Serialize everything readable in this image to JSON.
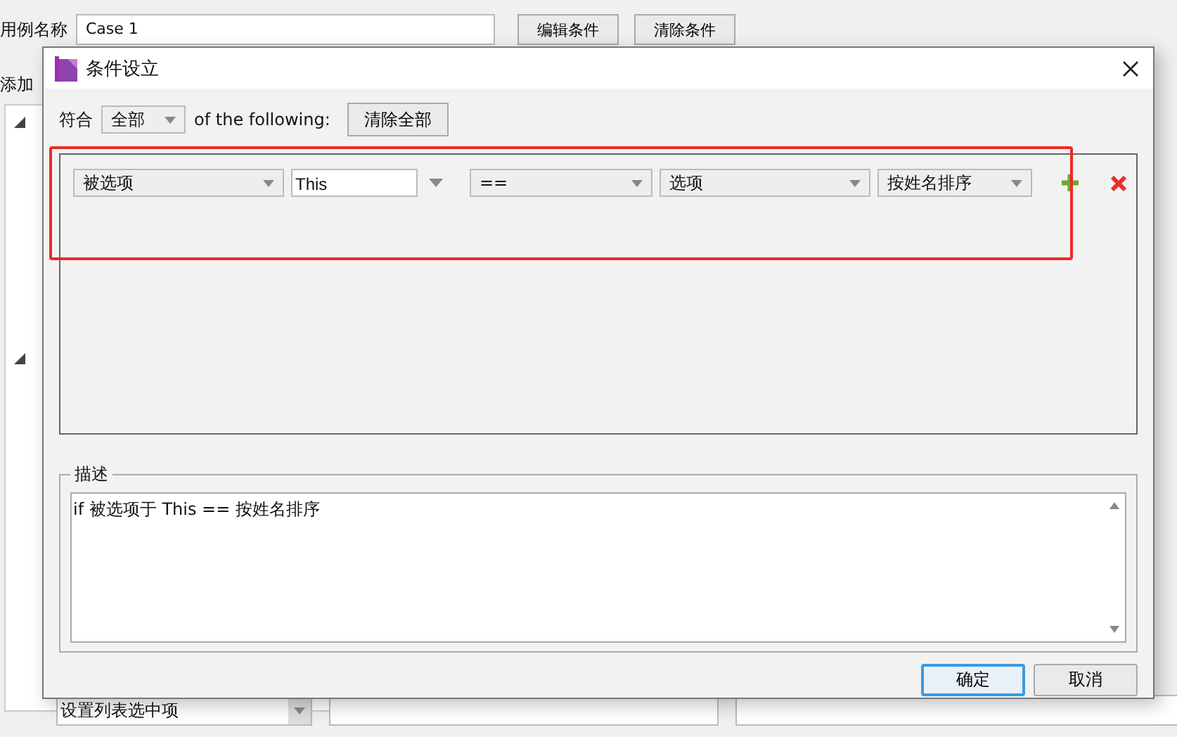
{
  "background": {
    "case_name_label": "用例名称",
    "case_name_value": "Case 1",
    "buttons": [
      "编辑条件",
      "清除条件"
    ],
    "add_label": "添加",
    "bottom_dropdown": "设置列表选中项"
  },
  "dialog": {
    "title": "条件设立",
    "match": {
      "label": "符合",
      "value": "全部",
      "suffix": "of the following:",
      "clear_button": "清除全部"
    },
    "conditions": [
      {
        "fields": [
          {
            "kind": "dropdown",
            "value": "被选项"
          },
          {
            "kind": "input",
            "value": "This"
          },
          {
            "kind": "dropdown",
            "value": "=="
          },
          {
            "kind": "dropdown",
            "value": "选项"
          },
          {
            "kind": "dropdown",
            "value": "按姓名排序"
          }
        ],
        "highlighted": true
      }
    ],
    "description": {
      "label": "描述",
      "text": "if 被选项于 This == 按姓名排序"
    },
    "buttons": [
      {
        "label": "确定",
        "default": true
      },
      {
        "label": "取消",
        "default": false
      }
    ]
  }
}
